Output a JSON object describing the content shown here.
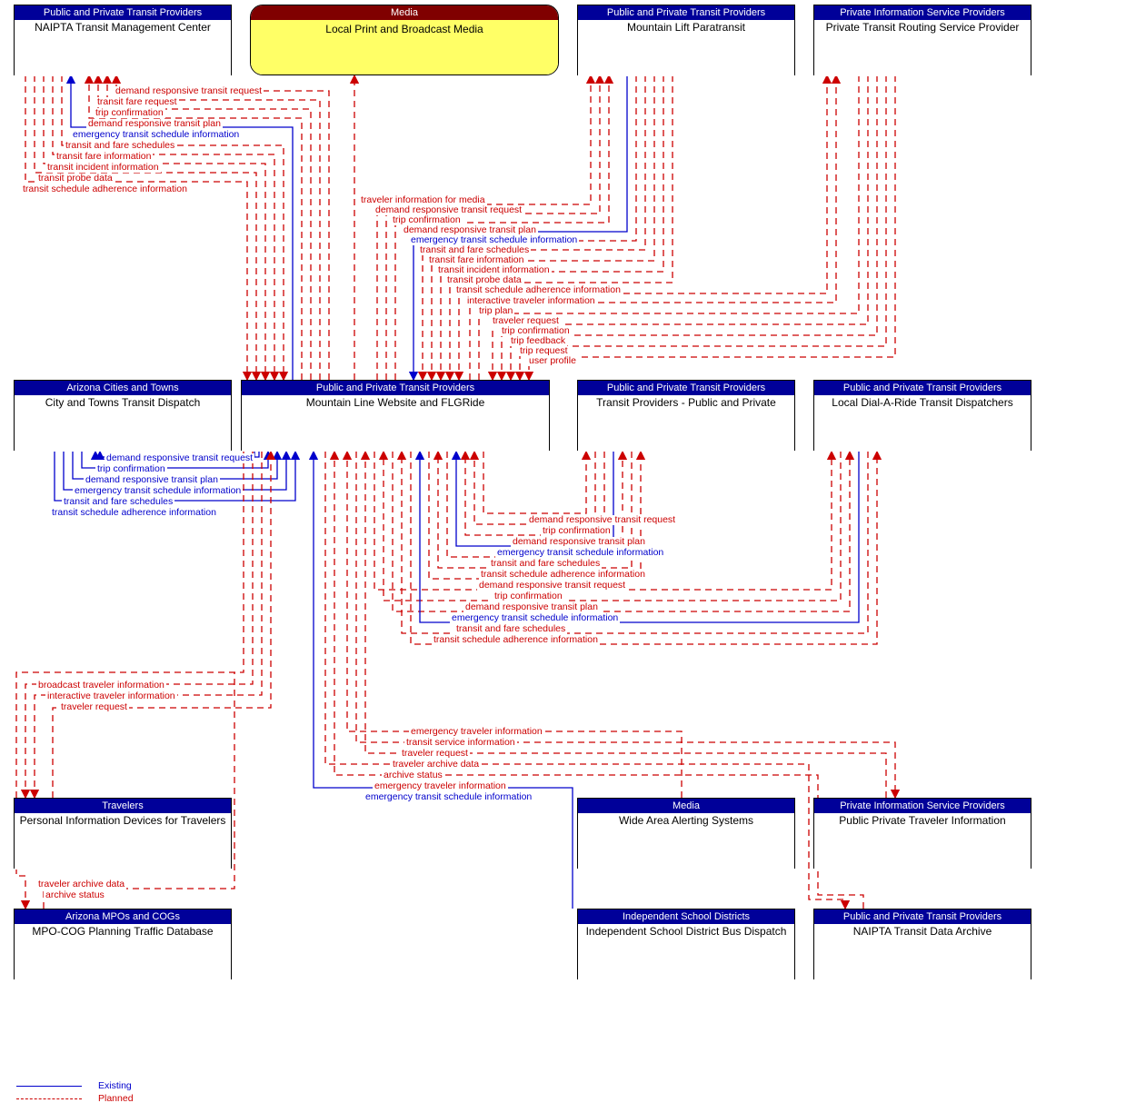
{
  "stakeholders": {
    "pptp": "Public and Private Transit Providers",
    "media": "Media",
    "pisp": "Private Information Service Providers",
    "act": "Arizona Cities and Towns",
    "trav": "Travelers",
    "mpo": "Arizona MPOs and COGs",
    "isd": "Independent School Districts"
  },
  "nodes": {
    "naipta_tmc": "NAIPTA Transit Management Center",
    "media_lpbm": "Local Print and Broadcast Media",
    "mlp": "Mountain Lift Paratransit",
    "ptrsp": "Private Transit Routing Service Provider",
    "ctt": "City and Towns Transit Dispatch",
    "mlw": "Mountain Line Website and FLGRide",
    "tppp": "Transit Providers - Public and Private",
    "ldar": "Local Dial-A-Ride Transit Dispatchers",
    "pidt": "Personal Information Devices for Travelers",
    "waa": "Wide Area Alerting Systems",
    "ppti": "Public  Private Traveler Information",
    "mpocog": "MPO-COG Planning Traffic Database",
    "isdbd": "Independent School District Bus Dispatch",
    "ntda": "NAIPTA Transit Data Archive"
  },
  "flows": {
    "drtr": "demand responsive transit request",
    "tfr": "transit fare request",
    "tc": "trip confirmation",
    "drtp": "demand responsive transit plan",
    "etsi": "emergency transit schedule information",
    "tfs": "transit and fare schedules",
    "tfi": "transit fare information",
    "tii": "transit incident information",
    "tpd": "transit probe data",
    "tsai": "transit schedule adherence information",
    "tifm": "traveler information for media",
    "iti": "interactive traveler information",
    "tp": "trip plan",
    "tr": "traveler request",
    "tc2": "trip confirmation",
    "tfb": "trip feedback",
    "trq": "trip request",
    "up": "user profile",
    "bti": "broadcast traveler information",
    "eti": "emergency traveler information",
    "tsi": "transit service information",
    "tad": "traveler archive data",
    "as": "archive status"
  },
  "legend": {
    "existing": "Existing",
    "planned": "Planned"
  }
}
